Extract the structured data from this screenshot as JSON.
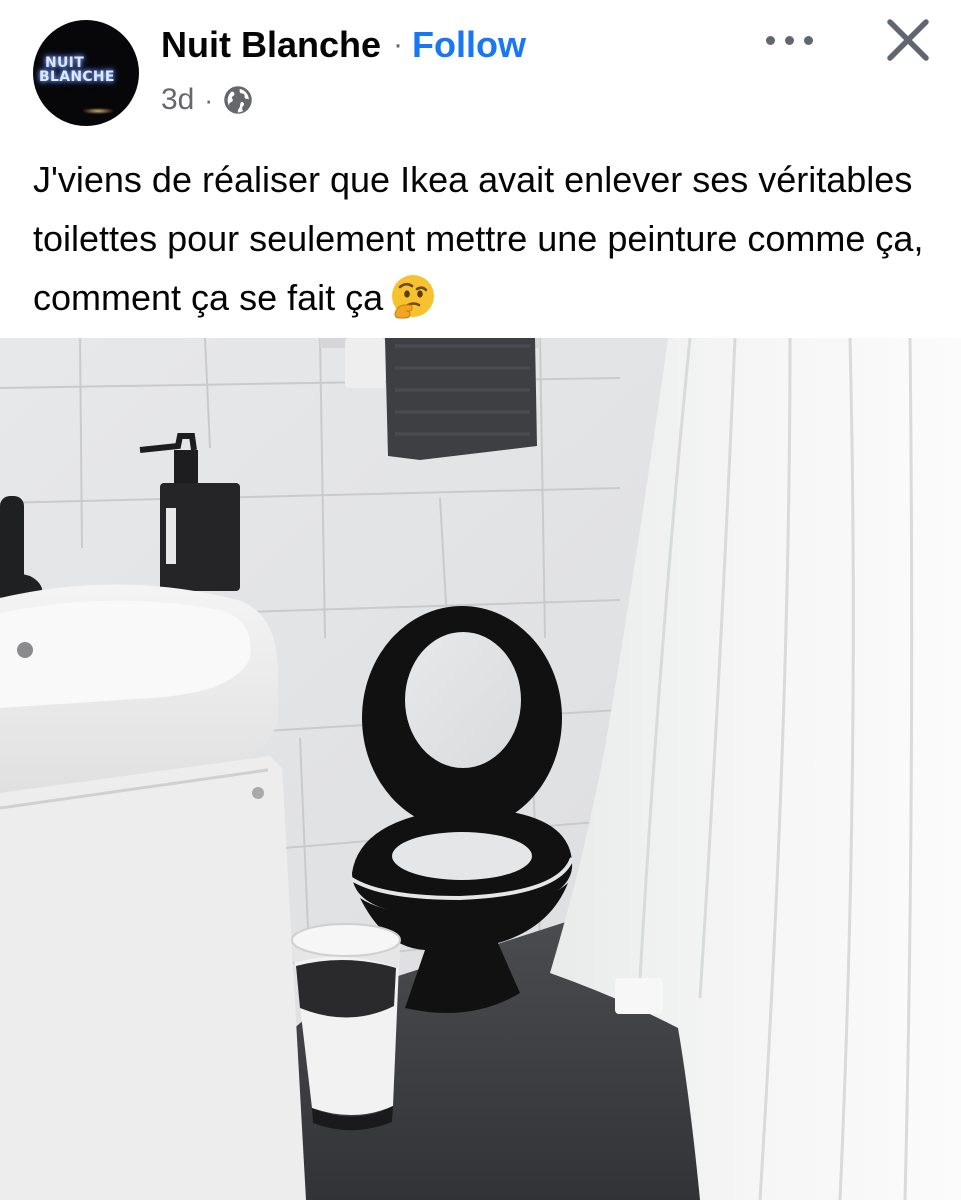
{
  "post": {
    "page_name": "Nuit Blanche",
    "separator": "·",
    "follow_label": "Follow",
    "timestamp": "3d",
    "meta_separator": "·",
    "audience_icon": "globe-icon",
    "avatar_logo_line1": "NUIT",
    "avatar_logo_line2": "BLANCHE",
    "more_icon": "more-horizontal-icon",
    "close_icon": "close-icon",
    "caption": "J'viens de réaliser que Ikea avait enlever ses véritables toilettes pour seulement mettre une peinture comme ça, comment ça se fait ça",
    "caption_emoji": "thinking-face-icon"
  },
  "colors": {
    "link_blue": "#1877f2",
    "secondary_text": "#65676b",
    "primary_text": "#050505"
  }
}
